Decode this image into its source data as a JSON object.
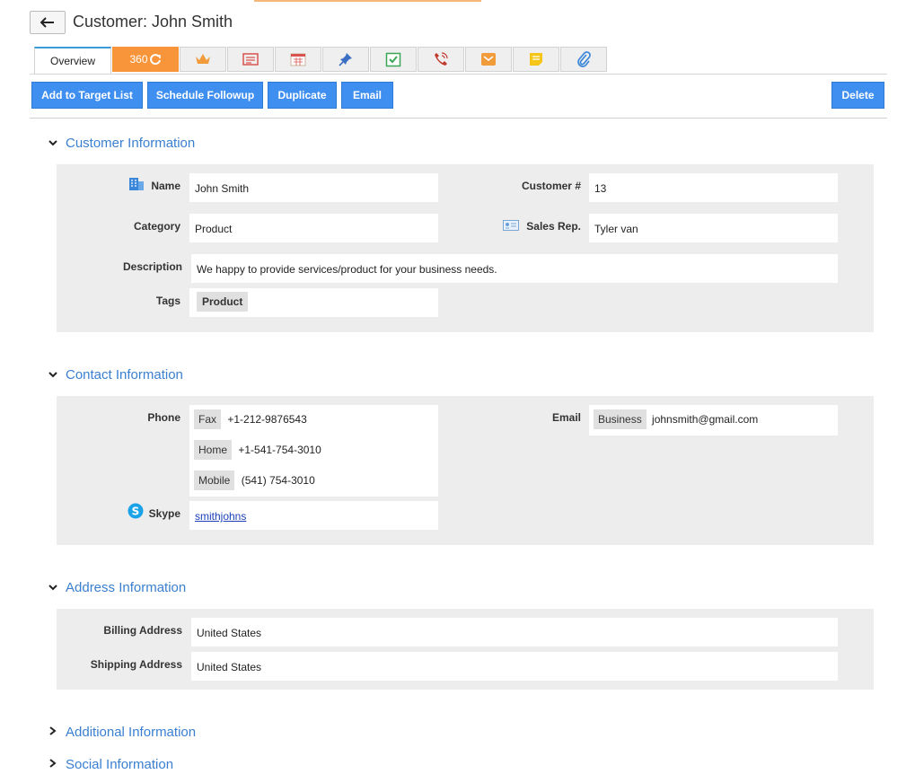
{
  "header": {
    "title": "Customer: John Smith"
  },
  "tabs": {
    "overview": "Overview",
    "t360": "360"
  },
  "toolbar": {
    "add_target": "Add to Target List",
    "schedule": "Schedule Followup",
    "duplicate": "Duplicate",
    "email": "Email",
    "delete": "Delete"
  },
  "customer": {
    "heading": "Customer Information",
    "name_label": "Name",
    "name": "John Smith",
    "customer_no_label": "Customer #",
    "customer_no": "13",
    "category_label": "Category",
    "category": "Product",
    "salesrep_label": "Sales Rep.",
    "salesrep": "Tyler van",
    "description_label": "Description",
    "description": "We happy to provide services/product for your business needs.",
    "tags_label": "Tags",
    "tag": "Product"
  },
  "contact": {
    "heading": "Contact Information",
    "phone_label": "Phone",
    "phones": [
      {
        "type": "Fax",
        "number": "+1-212-9876543"
      },
      {
        "type": "Home",
        "number": "+1-541-754-3010"
      },
      {
        "type": "Mobile",
        "number": "(541) 754-3010"
      }
    ],
    "email_label": "Email",
    "email_type": "Business",
    "email": "johnsmith@gmail.com",
    "skype_label": "Skype",
    "skype": "smithjohns"
  },
  "address": {
    "heading": "Address Information",
    "billing_label": "Billing Address",
    "billing": "United States",
    "shipping_label": "Shipping Address",
    "shipping": "United States"
  },
  "additional": {
    "heading": "Additional Information"
  },
  "social": {
    "heading": "Social Information"
  }
}
